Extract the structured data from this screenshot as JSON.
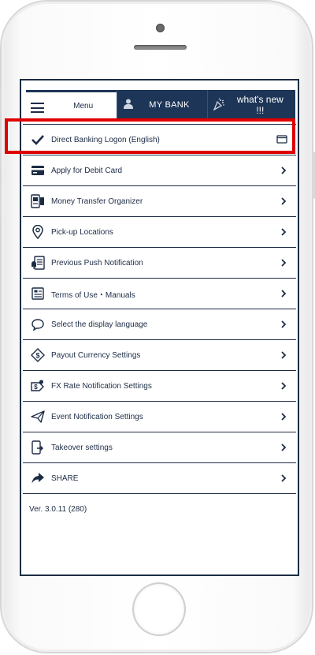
{
  "tabs": {
    "menu": "Menu",
    "my_bank": "MY BANK",
    "whats_new": "what's new !!!"
  },
  "menu_items": [
    {
      "label": "Direct Banking Logon (English)",
      "icon": "checkmark-icon"
    },
    {
      "label": "Apply for Debit Card",
      "icon": "card-icon"
    },
    {
      "label": "Money Transfer Organizer",
      "icon": "transfer-doc-icon"
    },
    {
      "label": "Pick-up Locations",
      "icon": "location-pin-icon"
    },
    {
      "label": "Previous Push Notification",
      "icon": "notification-list-icon"
    },
    {
      "label": "Terms of Use・Manuals",
      "icon": "document-icon"
    },
    {
      "label": "Select the display language",
      "icon": "speech-bubble-icon"
    },
    {
      "label": "Payout Currency Settings",
      "icon": "dollar-tag-icon"
    },
    {
      "label": "FX Rate Notification Settings",
      "icon": "fx-rate-icon"
    },
    {
      "label": "Event Notification Settings",
      "icon": "paper-plane-icon"
    },
    {
      "label": "Takeover settings",
      "icon": "phone-transfer-icon"
    },
    {
      "label": "SHARE",
      "icon": "share-arrow-icon"
    }
  ],
  "version": "Ver. 3.0.11 (280)",
  "colors": {
    "navy": "#1d3557",
    "highlight": "#e00000"
  }
}
